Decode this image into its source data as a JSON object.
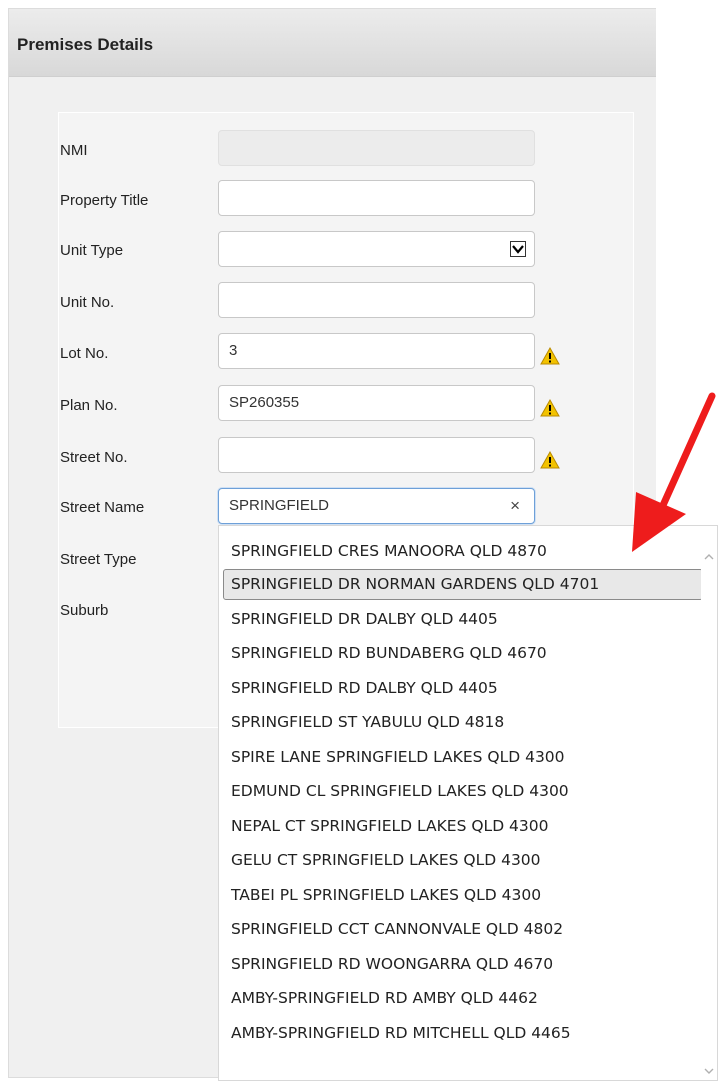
{
  "panel": {
    "title": "Premises Details"
  },
  "form": {
    "nmi": {
      "label": "NMI",
      "value": ""
    },
    "property_title": {
      "label": "Property Title",
      "value": ""
    },
    "unit_type": {
      "label": "Unit Type",
      "value": ""
    },
    "unit_no": {
      "label": "Unit No.",
      "value": ""
    },
    "lot_no": {
      "label": "Lot No.",
      "value": "3"
    },
    "plan_no": {
      "label": "Plan No.",
      "value": "SP260355"
    },
    "street_no": {
      "label": "Street No.",
      "value": ""
    },
    "street_name": {
      "label": "Street Name",
      "value": "SPRINGFIELD",
      "clear": "×"
    },
    "street_type": {
      "label": "Street Type"
    },
    "suburb": {
      "label": "Suburb"
    }
  },
  "suggestions": [
    "SPRINGFIELD CRES MANOORA QLD 4870",
    "SPRINGFIELD DR NORMAN GARDENS QLD 4701",
    "SPRINGFIELD DR DALBY QLD 4405",
    "SPRINGFIELD RD BUNDABERG QLD 4670",
    "SPRINGFIELD RD DALBY QLD 4405",
    "SPRINGFIELD ST YABULU QLD 4818",
    "SPIRE LANE SPRINGFIELD LAKES QLD 4300",
    "EDMUND CL SPRINGFIELD LAKES QLD 4300",
    "NEPAL CT SPRINGFIELD LAKES QLD 4300",
    "GELU CT SPRINGFIELD LAKES QLD 4300",
    "TABEI PL SPRINGFIELD LAKES QLD 4300",
    "SPRINGFIELD CCT CANNONVALE QLD 4802",
    "SPRINGFIELD RD WOONGARRA QLD 4670",
    "AMBY-SPRINGFIELD RD AMBY QLD 4462",
    "AMBY-SPRINGFIELD RD MITCHELL QLD 4465"
  ],
  "colors": {
    "warning": "#f2c200",
    "pointer_arrow": "#ee1c1c",
    "focus_border": "#6ea0d8"
  },
  "icons": {
    "warning": "warning-triangle-icon",
    "dropdown": "chevron-down-icon",
    "clear": "clear-icon"
  }
}
